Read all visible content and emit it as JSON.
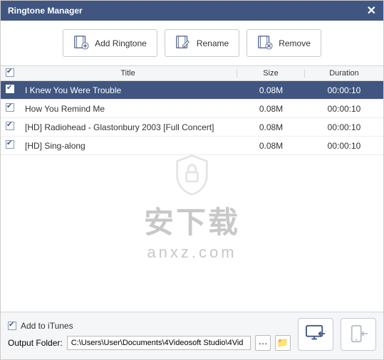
{
  "titlebar": {
    "title": "Ringtone Manager"
  },
  "toolbar": {
    "add_label": "Add Ringtone",
    "rename_label": "Rename",
    "remove_label": "Remove"
  },
  "columns": {
    "title": "Title",
    "size": "Size",
    "duration": "Duration"
  },
  "rows": [
    {
      "checked": true,
      "selected": true,
      "title": "I Knew You Were Trouble",
      "size": "0.08M",
      "duration": "00:00:10"
    },
    {
      "checked": true,
      "selected": false,
      "title": "How You Remind Me",
      "size": "0.08M",
      "duration": "00:00:10"
    },
    {
      "checked": true,
      "selected": false,
      "title": "[HD] Radiohead - Glastonbury 2003 [Full Concert]",
      "size": "0.08M",
      "duration": "00:00:10"
    },
    {
      "checked": true,
      "selected": false,
      "title": "[HD] Sing-along",
      "size": "0.08M",
      "duration": "00:00:10"
    }
  ],
  "watermark": {
    "line1": "安下载",
    "line2": "anxz.com"
  },
  "footer": {
    "add_itunes_label": "Add to iTunes",
    "add_itunes_checked": true,
    "output_label": "Output Folder:",
    "output_path": "C:\\Users\\User\\Documents\\4Videosoft Studio\\4Vid",
    "more": "···",
    "browse": "📁"
  }
}
